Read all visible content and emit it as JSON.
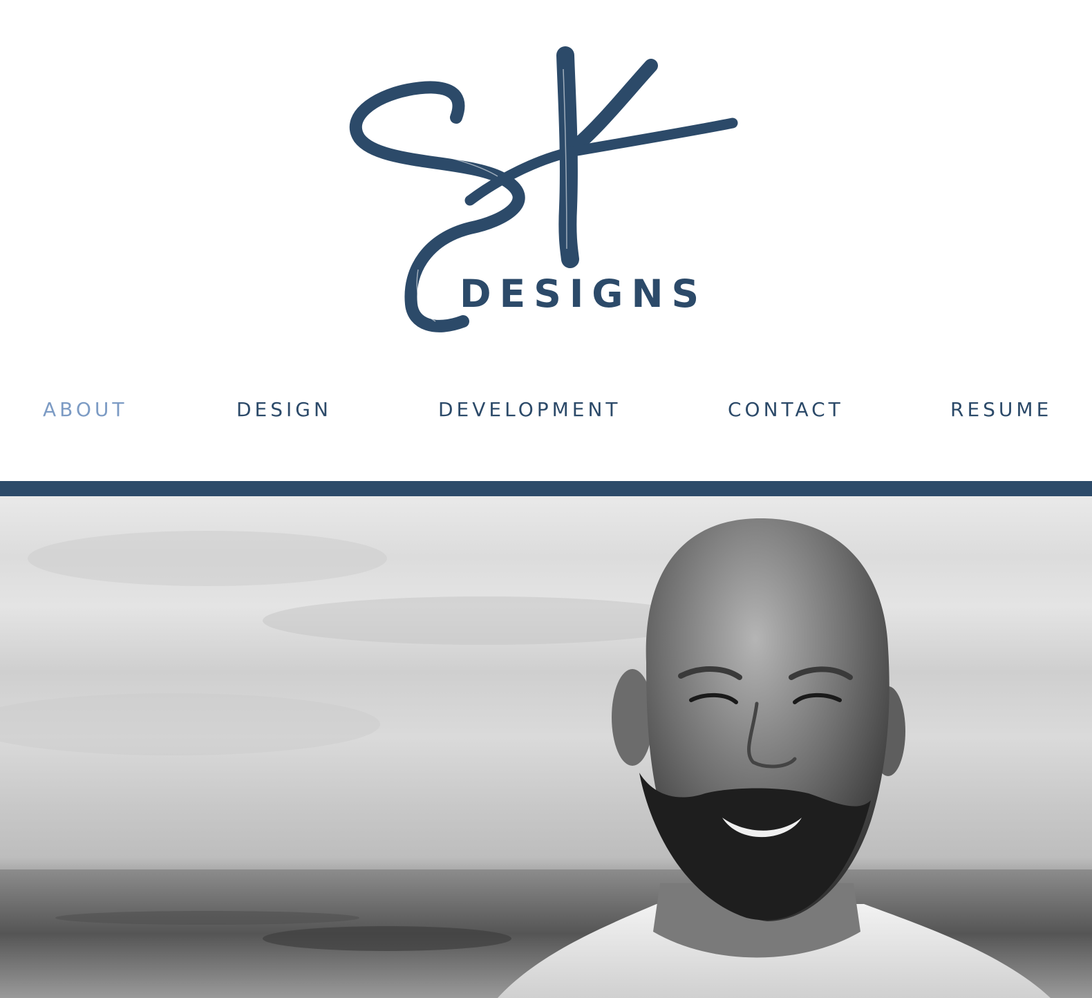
{
  "logo": {
    "monogram": "SK",
    "wordmark": "DESIGNS"
  },
  "nav": {
    "items": [
      {
        "label": "ABOUT",
        "active": true
      },
      {
        "label": "DESIGN",
        "active": false
      },
      {
        "label": "DEVELOPMENT",
        "active": false
      },
      {
        "label": "CONTACT",
        "active": false
      },
      {
        "label": "RESUME",
        "active": false
      }
    ]
  },
  "hero": {
    "image": "portrait-photo"
  },
  "colors": {
    "brand": "#2c4a69",
    "nav_active": "#7c9bc4",
    "background": "#ffffff"
  }
}
